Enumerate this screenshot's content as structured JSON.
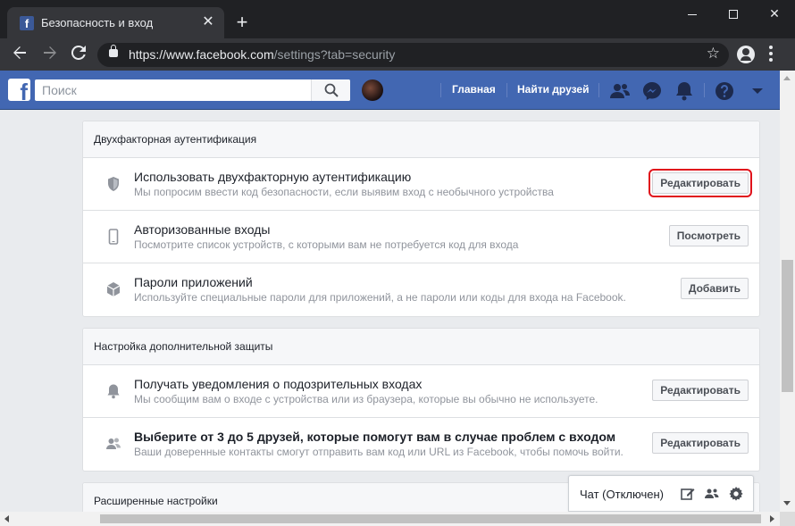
{
  "browser": {
    "tab_title": "Безопасность и вход",
    "tab_favicon": "f",
    "url_host": "https://www.facebook.com",
    "url_path": "/settings?tab=security",
    "new_tab": "+",
    "close_tab": "✕"
  },
  "fb": {
    "search_placeholder": "Поиск",
    "home_link": "Главная",
    "find_friends_link": "Найти друзей",
    "logo_letter": "f"
  },
  "sections": [
    {
      "heading": "Двухфакторная аутентификация",
      "rows": [
        {
          "icon": "shield-icon",
          "title": "Использовать двухфакторную аутентификацию",
          "subtitle": "Мы попросим ввести код безопасности, если выявим вход с необычного устройства",
          "button": "Редактировать",
          "highlight": true
        },
        {
          "icon": "phone-icon",
          "title": "Авторизованные входы",
          "subtitle": "Посмотрите список устройств, с которыми вам не потребуется код для входа",
          "button": "Посмотреть"
        },
        {
          "icon": "cube-icon",
          "title": "Пароли приложений",
          "subtitle": "Используйте специальные пароли для приложений, а не пароли или коды для входа на Facebook.",
          "button": "Добавить"
        }
      ]
    },
    {
      "heading": "Настройка дополнительной защиты",
      "rows": [
        {
          "icon": "bell-icon",
          "title": "Получать уведомления о подозрительных входах",
          "subtitle": "Мы сообщим вам о входе с устройства или из браузера, которые вы обычно не используете.",
          "button": "Редактировать"
        },
        {
          "icon": "friends-icon",
          "title": "Выберите от 3 до 5 друзей, которые помогут вам в случае проблем с входом",
          "subtitle": "Ваши доверенные контакты смогут отправить вам код или URL из Facebook, чтобы помочь войти.",
          "button": "Редактировать"
        }
      ]
    },
    {
      "heading": "Расширенные настройки",
      "rows": []
    }
  ],
  "chat": {
    "label": "Чат (Отключен)"
  },
  "colors": {
    "fb_blue": "#4267b2",
    "highlight_red": "#e0121b"
  }
}
